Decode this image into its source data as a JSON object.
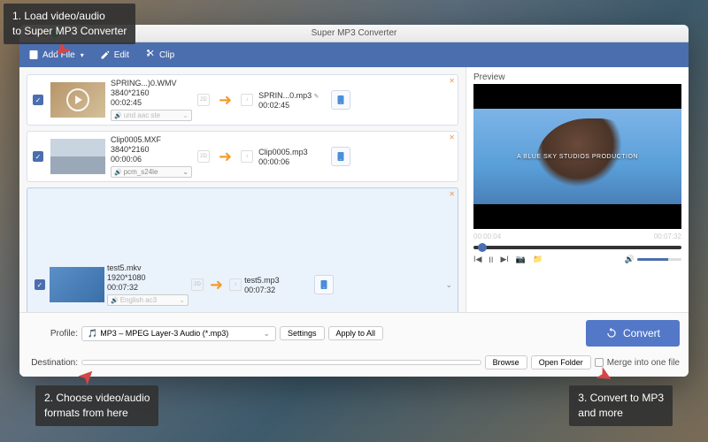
{
  "callouts": {
    "c1": "1. Load video/audio\nto Super MP3 Converter",
    "c2": "2. Choose video/audio\nformats from here",
    "c3": "3. Convert to MP3\nand more"
  },
  "window": {
    "title": "Super MP3 Converter"
  },
  "toolbar": {
    "add_file": "Add File",
    "edit": "Edit",
    "clip": "Clip"
  },
  "items": [
    {
      "in_name": "SPRING...)0.WMV",
      "res": "3840*2160",
      "dur": "00:02:45",
      "audio": "und aac ste",
      "audio_dim": true,
      "out_name": "SPRIN...0.mp3",
      "out_dur": "00:02:45",
      "pen": true
    },
    {
      "in_name": "Clip0005.MXF",
      "res": "3840*2160",
      "dur": "00:00:06",
      "audio": "pcm_s24le",
      "audio_dim": false,
      "out_name": "Clip0005.mp3",
      "out_dur": "00:00:06",
      "pen": false
    },
    {
      "in_name": "test5.mkv",
      "res": "1920*1080",
      "dur": "00:07:32",
      "audio": "English ac3",
      "audio_dim": true,
      "out_name": "test5.mp3",
      "out_dur": "00:07:32",
      "pen": false
    }
  ],
  "preview": {
    "label": "Preview",
    "overlay_text": "A BLUE SKY STUDIOS PRODUCTION",
    "cur": "00:00:04",
    "total": "00:07:32"
  },
  "bottom": {
    "profile_label": "Profile:",
    "profile_value": "MP3 – MPEG Layer-3 Audio (*.mp3)",
    "settings": "Settings",
    "apply_all": "Apply to All",
    "dest_label": "Destination:",
    "dest_value": "",
    "browse": "Browse",
    "open_folder": "Open Folder",
    "merge": "Merge into one file",
    "convert": "Convert"
  }
}
